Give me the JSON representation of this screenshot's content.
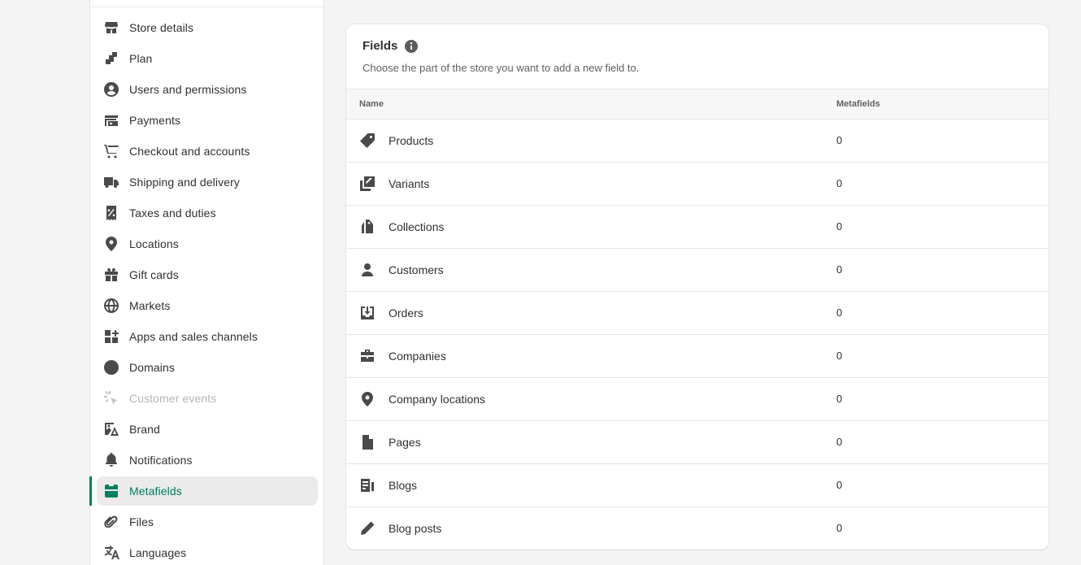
{
  "sidebar": {
    "items": [
      {
        "label": "Store details",
        "icon": "store-icon"
      },
      {
        "label": "Plan",
        "icon": "plan-icon"
      },
      {
        "label": "Users and permissions",
        "icon": "user-circle-icon"
      },
      {
        "label": "Payments",
        "icon": "payments-icon"
      },
      {
        "label": "Checkout and accounts",
        "icon": "cart-icon"
      },
      {
        "label": "Shipping and delivery",
        "icon": "truck-icon"
      },
      {
        "label": "Taxes and duties",
        "icon": "receipt-percent-icon"
      },
      {
        "label": "Locations",
        "icon": "location-pin-icon"
      },
      {
        "label": "Gift cards",
        "icon": "gift-icon"
      },
      {
        "label": "Markets",
        "icon": "globe-market-icon"
      },
      {
        "label": "Apps and sales channels",
        "icon": "apps-icon"
      },
      {
        "label": "Domains",
        "icon": "globe-icon"
      },
      {
        "label": "Customer events",
        "icon": "cursor-sparkle-icon",
        "disabled": true
      },
      {
        "label": "Brand",
        "icon": "brand-image-icon"
      },
      {
        "label": "Notifications",
        "icon": "bell-icon"
      },
      {
        "label": "Metafields",
        "icon": "metafields-icon",
        "active": true
      },
      {
        "label": "Files",
        "icon": "paperclip-icon"
      },
      {
        "label": "Languages",
        "icon": "translate-icon"
      }
    ]
  },
  "fields_card": {
    "title": "Fields",
    "subtitle": "Choose the part of the store you want to add a new field to.",
    "columns": {
      "name": "Name",
      "metafields": "Metafields"
    },
    "rows": [
      {
        "name": "Products",
        "count": "0",
        "icon": "tag-icon"
      },
      {
        "name": "Variants",
        "count": "0",
        "icon": "variants-icon"
      },
      {
        "name": "Collections",
        "count": "0",
        "icon": "collections-icon"
      },
      {
        "name": "Customers",
        "count": "0",
        "icon": "person-icon"
      },
      {
        "name": "Orders",
        "count": "0",
        "icon": "inbox-download-icon"
      },
      {
        "name": "Companies",
        "count": "0",
        "icon": "briefcase-icon"
      },
      {
        "name": "Company locations",
        "count": "0",
        "icon": "location-pin-icon"
      },
      {
        "name": "Pages",
        "count": "0",
        "icon": "page-icon"
      },
      {
        "name": "Blogs",
        "count": "0",
        "icon": "blog-icon"
      },
      {
        "name": "Blog posts",
        "count": "0",
        "icon": "pencil-icon"
      }
    ]
  },
  "colors": {
    "accent": "#008060",
    "background": "#f4f4f5",
    "card": "#ffffff",
    "text": "#303030",
    "muted": "#616161"
  }
}
